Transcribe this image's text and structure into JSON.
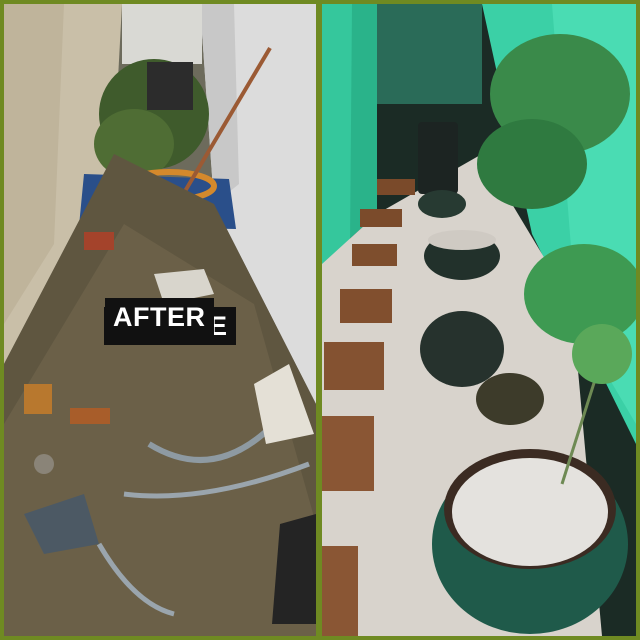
{
  "labels": {
    "before": "BEFORE",
    "after": "AFTER"
  },
  "colors": {
    "border": "#6f8a22",
    "label_bg": "#111111",
    "label_text": "#ffffff",
    "after_light": "#2fd6a8"
  }
}
